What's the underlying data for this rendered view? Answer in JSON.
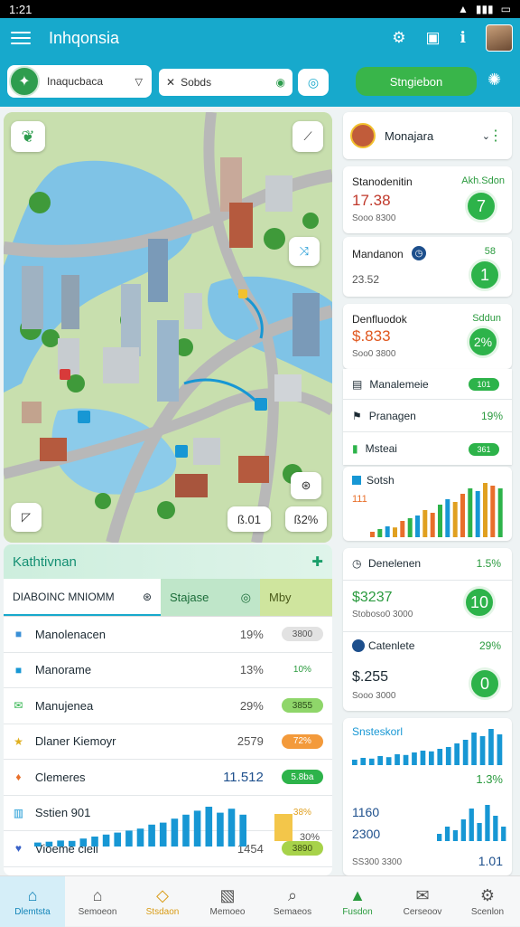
{
  "status_bar": {
    "time": "1:21",
    "icons": [
      "signal-icon",
      "wifi-icon",
      "battery-icon"
    ]
  },
  "app_bar": {
    "title": "Inhqonsia",
    "icons": [
      "menu-icon",
      "gear-icon",
      "briefcase-icon",
      "info-icon"
    ]
  },
  "toolbar": {
    "location_label": "Inaqucbaca",
    "search_label": "Sobds",
    "start_button": "Stngiebon"
  },
  "map": {
    "readout_left": "ß.01",
    "readout_right": "ß2%"
  },
  "activity": {
    "title": "Kathtivnan",
    "tabs": [
      "DIABOINC MNIOMM",
      "Stajase",
      "Mby"
    ],
    "rows": [
      {
        "name": "Manolenacen",
        "pct": "19%",
        "badge": "3800",
        "icon": "square-icon",
        "color": "#3a8fd6",
        "badge_color": "#e2e2e2",
        "badge_text_color": "#555"
      },
      {
        "name": "Manorame",
        "pct": "13%",
        "badge": "10%",
        "icon": "square-icon",
        "color": "#1797d4",
        "badge_color": "#ffffff",
        "badge_text_color": "#2a9a3e"
      },
      {
        "name": "Manujenea",
        "pct": "29%",
        "badge": "3855",
        "icon": "mail-icon",
        "color": "#2db34a",
        "badge_color": "#8fd66a",
        "badge_text_color": "#2b4a1a"
      },
      {
        "name": "Dlaner Kiemoyr",
        "pct": "2579",
        "badge": "72%",
        "icon": "star-icon",
        "color": "#e0b020",
        "badge_color": "#f39a3b",
        "badge_text_color": "#fff"
      },
      {
        "name": "Clemeres",
        "pct": "11.512",
        "badge": "5.8ba",
        "icon": "flame-icon",
        "color": "#e86f2a",
        "badge_color": "#2db34a",
        "badge_text_color": "#fff"
      },
      {
        "name": "Sstien 901",
        "pct": "",
        "badge": "38%",
        "icon": "chart-icon",
        "color": "#1797d4",
        "badge_color": "#ffffff",
        "badge_text_color": "#e0a020"
      },
      {
        "name": "Vioeme cieil",
        "pct": "1454",
        "badge": "3890",
        "icon": "drop-icon",
        "color": "#3a63c8",
        "badge_color": "#a7d24a",
        "badge_text_color": "#3b4a15"
      }
    ],
    "extra_pct": "30%"
  },
  "profile": {
    "name": "Monajara"
  },
  "stats": [
    {
      "title": "Stanodenitin",
      "value": "17.38",
      "sub": "Sooo 8300",
      "tag": "Akh.Sdon",
      "circle": "7"
    },
    {
      "title": "Mandanon",
      "value": "",
      "sub": "23.52",
      "tag": "58",
      "circle": "1"
    },
    {
      "title": "Denfluodok",
      "value": "$.833",
      "sub": "Soo0 3800",
      "tag": "Sddun",
      "circle": "2%"
    }
  ],
  "list_items": [
    {
      "name": "Manalemeie",
      "badge": "101",
      "icon": "doc-icon"
    },
    {
      "name": "Pranagen",
      "badge": "19%",
      "icon": "flag-icon"
    },
    {
      "name": "Msteai",
      "badge": "361",
      "icon": "mail-icon"
    }
  ],
  "spark_card": {
    "title": "Sotsh",
    "value": "111"
  },
  "stats2": [
    {
      "title": "Denelenen",
      "pct": "1.5%",
      "value": "$3237",
      "sub": "Stoboso0 3000",
      "circle": "10"
    },
    {
      "title": "Catenlete",
      "pct": "29%",
      "value": "$.255",
      "sub": "Sooo 3000",
      "circle": "0"
    }
  ],
  "bottom_card": {
    "title": "Snsteskorl",
    "pct": "1.3%",
    "v1": "1160",
    "v2": "2300",
    "foot_left": "SS300 3300",
    "foot_right": "1.01"
  },
  "nav": [
    "Dlemtsta",
    "Semoeon",
    "Stsdaon",
    "Memoeo",
    "Semaeos",
    "Fusdon",
    "Cerseoov",
    "Scenlon"
  ],
  "colors": {
    "primary": "#17a9cc",
    "green": "#2db34a",
    "red": "#c0392b",
    "orange": "#e86f2a"
  }
}
